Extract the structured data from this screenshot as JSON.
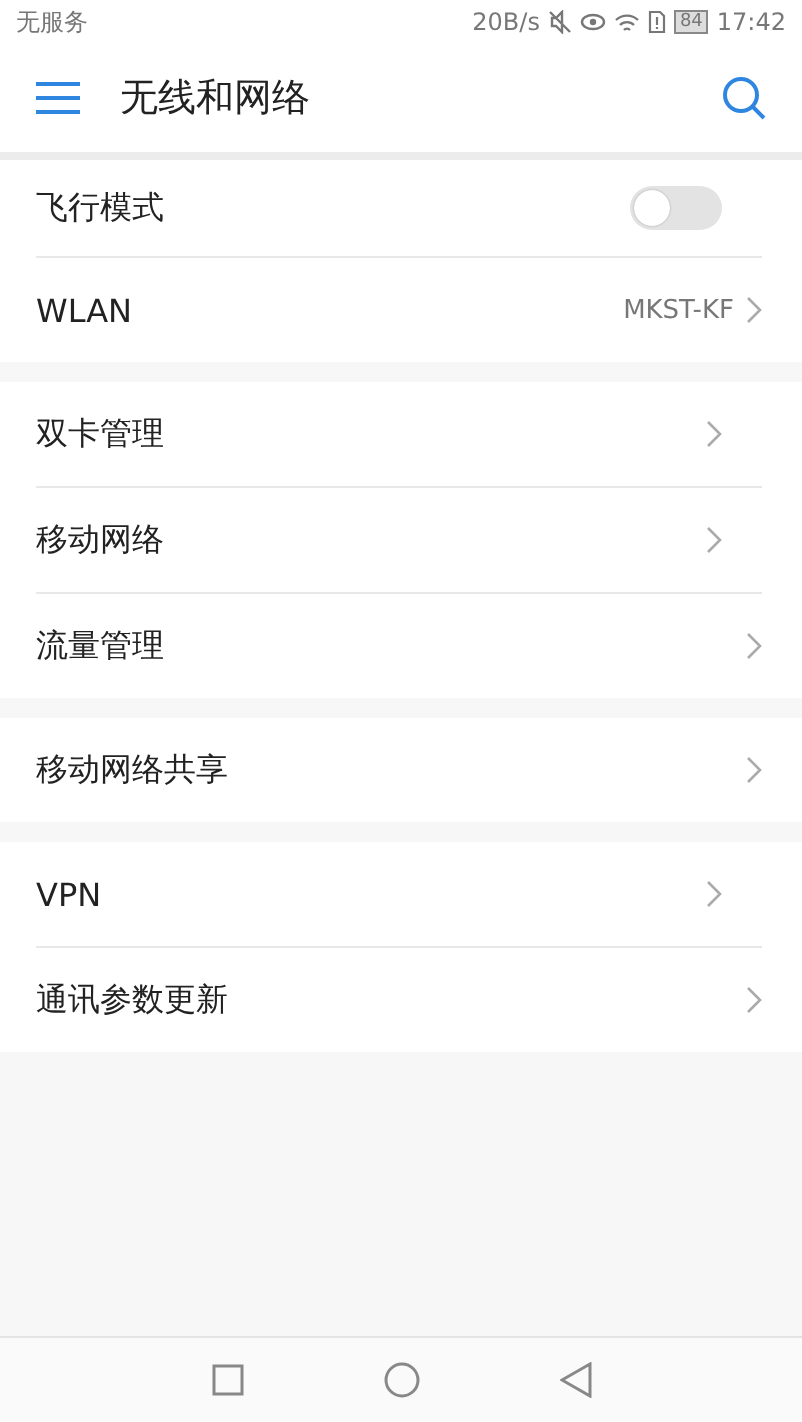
{
  "status_bar": {
    "carrier": "无服务",
    "speed": "20B/s",
    "battery": "84",
    "time": "17:42"
  },
  "header": {
    "title": "无线和网络"
  },
  "groups": [
    {
      "items": [
        {
          "kind": "toggle",
          "label": "飞行模式",
          "on": false
        },
        {
          "kind": "link",
          "label": "WLAN",
          "value": "MKST-KF"
        }
      ]
    },
    {
      "items": [
        {
          "kind": "link",
          "label": "双卡管理"
        },
        {
          "kind": "link",
          "label": "移动网络"
        },
        {
          "kind": "link",
          "label": "流量管理"
        }
      ]
    },
    {
      "items": [
        {
          "kind": "link",
          "label": "移动网络共享"
        }
      ]
    },
    {
      "items": [
        {
          "kind": "link",
          "label": "VPN"
        },
        {
          "kind": "link",
          "label": "通讯参数更新"
        }
      ]
    }
  ]
}
